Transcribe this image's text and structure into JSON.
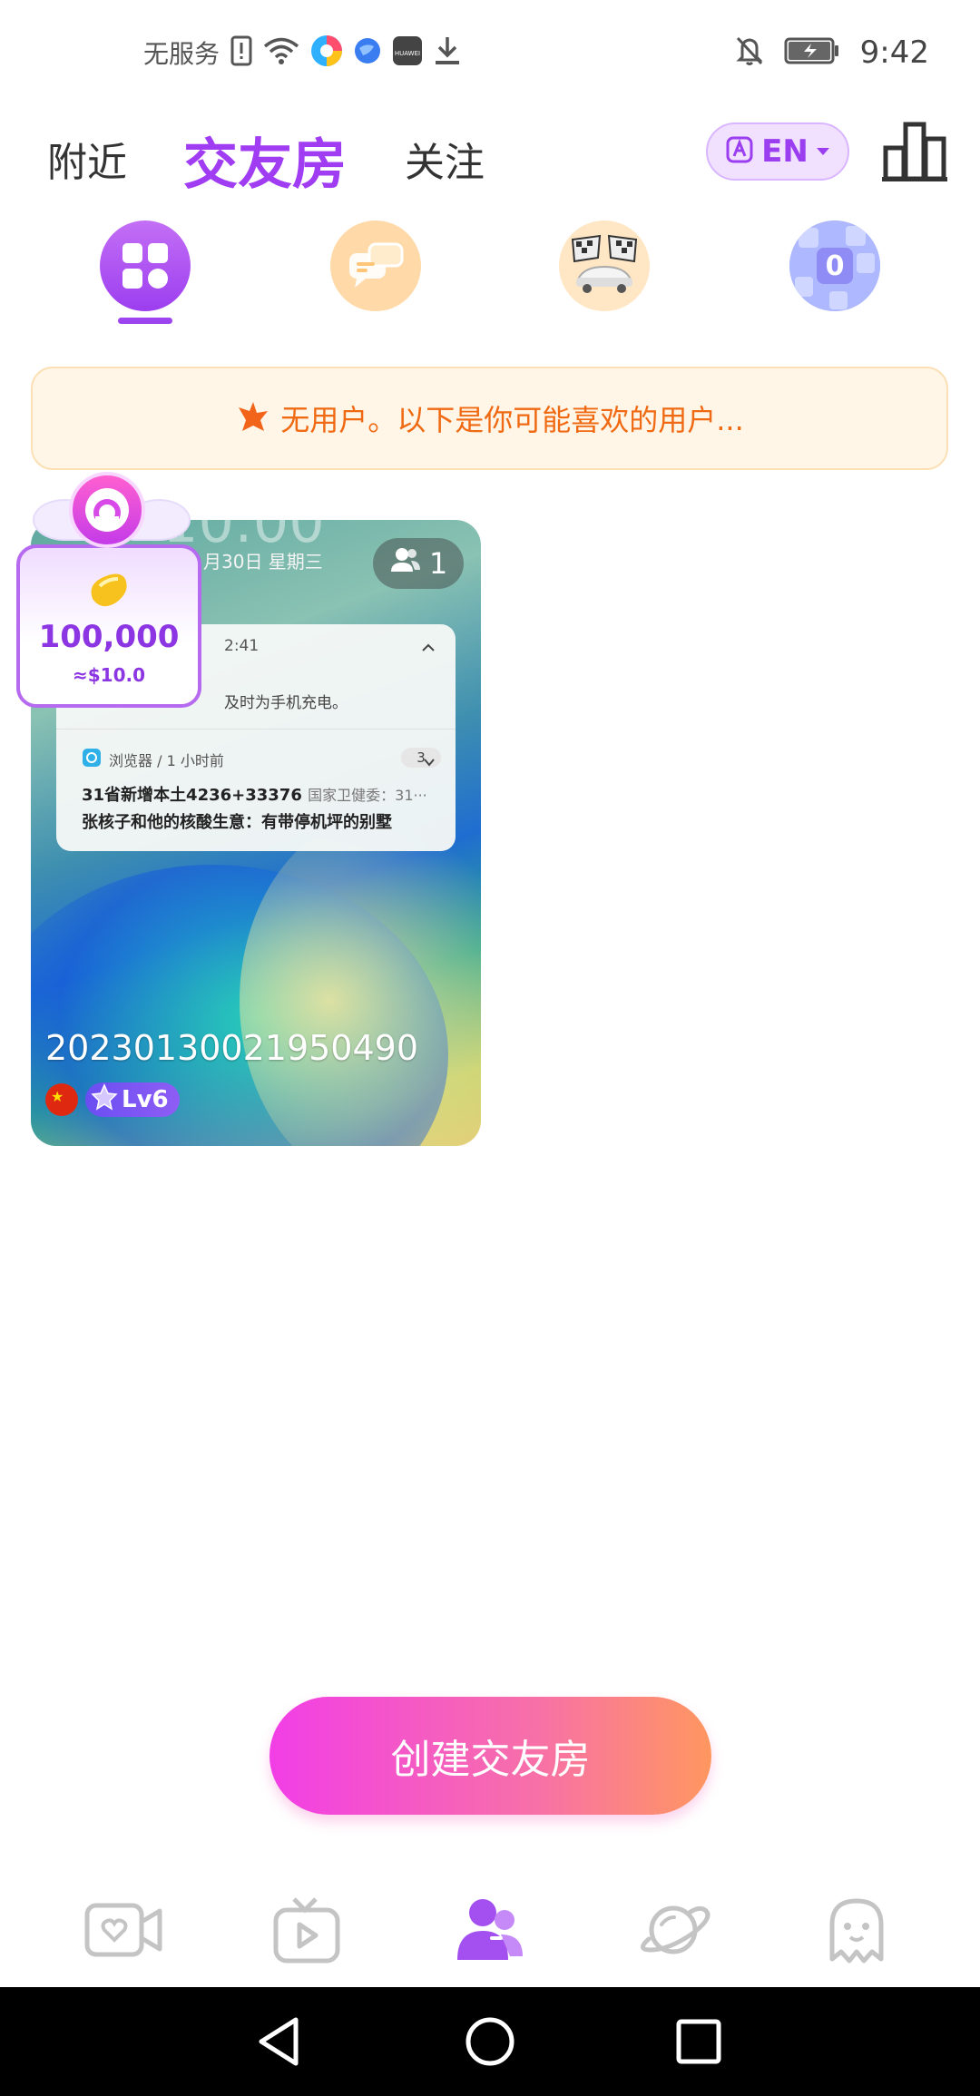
{
  "status_bar": {
    "carrier": "无服务",
    "time": "9:42",
    "icons": [
      "sim-alert-icon",
      "wifi-icon",
      "browser-app-icon",
      "globe-app-icon",
      "huawei-app-icon",
      "download-icon",
      "bell-off-icon",
      "battery-charging-icon"
    ]
  },
  "top_nav": {
    "tabs": [
      {
        "label": "附近",
        "active": false
      },
      {
        "label": "交友房",
        "active": true
      },
      {
        "label": "关注",
        "active": false
      }
    ],
    "language": "EN",
    "rank_icon": "leaderboard-icon"
  },
  "categories": [
    {
      "name": "grid-category-icon",
      "selected": true
    },
    {
      "name": "chat-category-icon",
      "selected": false
    },
    {
      "name": "racing-category-icon",
      "selected": false
    },
    {
      "name": "number-game-category-icon",
      "selected": false
    }
  ],
  "notice": {
    "text": "无用户。以下是你可能喜欢的用户..."
  },
  "room_card": {
    "participants": "1",
    "owner_id": "20230130021950490",
    "level": "Lv6",
    "preview": {
      "big_time": "10:00",
      "date": "月30日  星期三",
      "panel_time": "2:41",
      "panel_line1": "及时为手机充电。",
      "app_label": "浏览器 / 1 小时前",
      "app_count": "3",
      "news1_main": "31省新增本土4236+33376",
      "news1_tail": "国家卫健委：31···",
      "news2": "张核子和他的核酸生意：有带停机坪的别墅"
    },
    "gift": {
      "amount": "100,000",
      "usd": "≈$10.0"
    }
  },
  "create_button": {
    "label": "创建交友房"
  },
  "bottom_tabs": [
    {
      "name": "video-call-tab-icon",
      "active": false
    },
    {
      "name": "live-tv-tab-icon",
      "active": false
    },
    {
      "name": "party-room-tab-icon",
      "active": true
    },
    {
      "name": "planet-tab-icon",
      "active": false
    },
    {
      "name": "ghost-tab-icon",
      "active": false
    }
  ],
  "colors": {
    "accent": "#a03cf2",
    "notice_text": "#ef6a12",
    "notice_bg": "#fff6e8",
    "button_start": "#f23ee6",
    "button_end": "#ff9760"
  }
}
